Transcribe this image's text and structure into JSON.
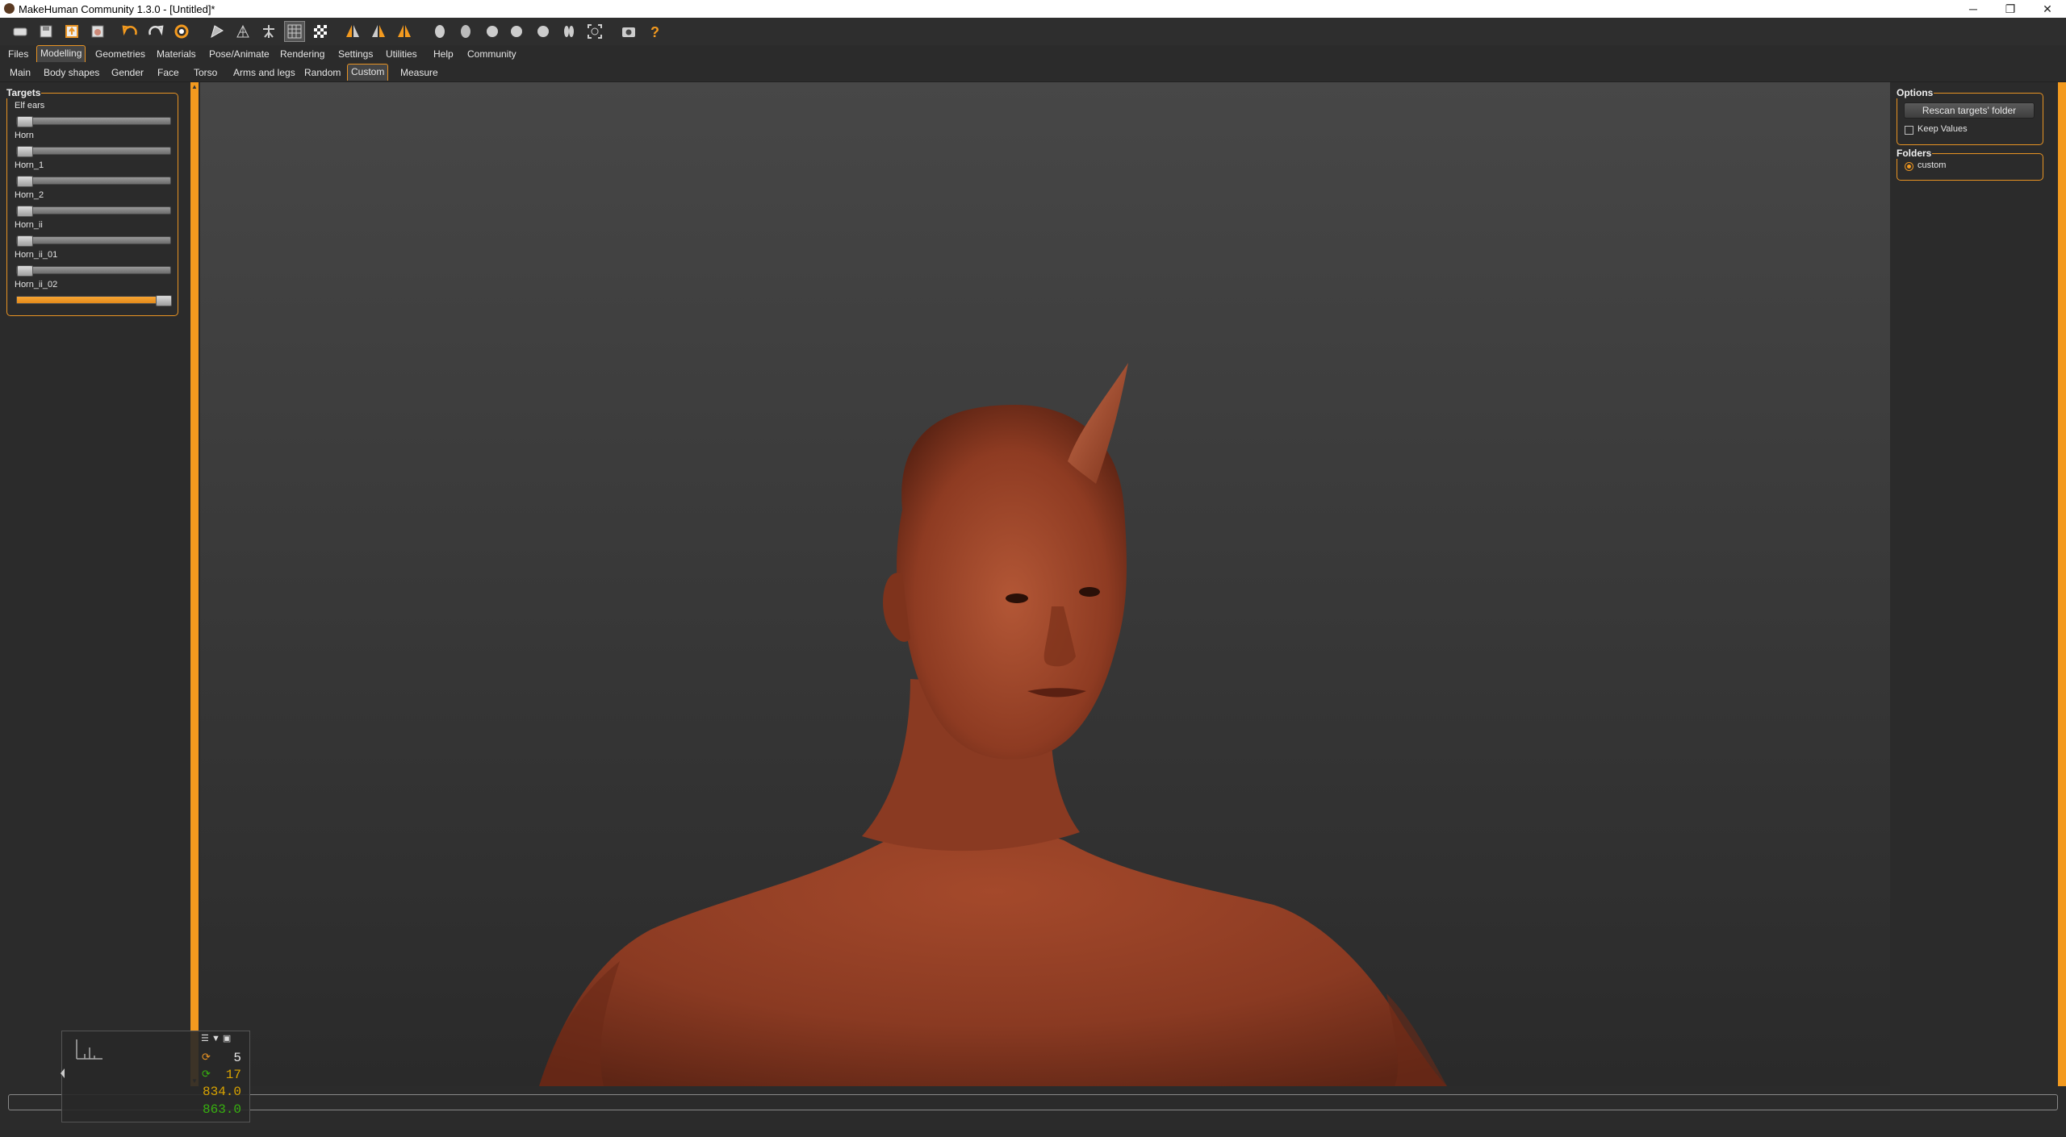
{
  "window": {
    "title": "MakeHuman Community 1.3.0 - [Untitled]*",
    "minimize_glyph": "─",
    "maximize_glyph": "❐",
    "close_glyph": "✕"
  },
  "toolbar": {
    "icons": [
      "new-icon",
      "save-icon",
      "export-icon",
      "load-icon",
      "undo-icon",
      "redo-icon",
      "reset-icon",
      "smooth-icon",
      "wireframe-icon",
      "pose-icon",
      "grid-icon",
      "background-icon",
      "symmetry-right-icon",
      "symmetry-left-icon",
      "symmetry-icon",
      "front-view-icon",
      "back-view-icon",
      "left-view-icon",
      "right-view-icon",
      "top-view-icon",
      "bottom-view-icon",
      "reset-camera-icon",
      "screenshot-icon",
      "help-icon"
    ]
  },
  "menu": {
    "tabs": [
      "Files",
      "Modelling",
      "Geometries",
      "Materials",
      "Pose/Animate",
      "Rendering",
      "Settings",
      "Utilities",
      "Help",
      "Community"
    ],
    "active": "Modelling"
  },
  "subtabs": {
    "tabs": [
      "Main",
      "Body shapes",
      "Gender",
      "Face",
      "Torso",
      "Arms and legs",
      "Random",
      "Custom",
      "Measure"
    ],
    "active": "Custom"
  },
  "targets": {
    "title": "Targets",
    "items": [
      {
        "label": "Elf ears",
        "value": 0.0
      },
      {
        "label": "Horn",
        "value": 0.0
      },
      {
        "label": "Horn_1",
        "value": 0.0
      },
      {
        "label": "Horn_2",
        "value": 0.0
      },
      {
        "label": "Horn_ii",
        "value": 0.0
      },
      {
        "label": "Horn_ii_01",
        "value": 0.0
      },
      {
        "label": "Horn_ii_02",
        "value": 1.0
      }
    ]
  },
  "options": {
    "title": "Options",
    "rescan_label": "Rescan targets' folder",
    "keep_values_label": "Keep Values",
    "keep_values_checked": false
  },
  "folders": {
    "title": "Folders",
    "items": [
      {
        "label": "custom",
        "selected": true
      }
    ]
  },
  "stats": {
    "v1": "5",
    "v2": "17",
    "v3": "834.0",
    "v4": "863.0"
  },
  "colors": {
    "accent": "#f39a1f",
    "skin": "#8a3a22",
    "stat_orange": "#d9a300",
    "stat_green": "#37b10f"
  }
}
